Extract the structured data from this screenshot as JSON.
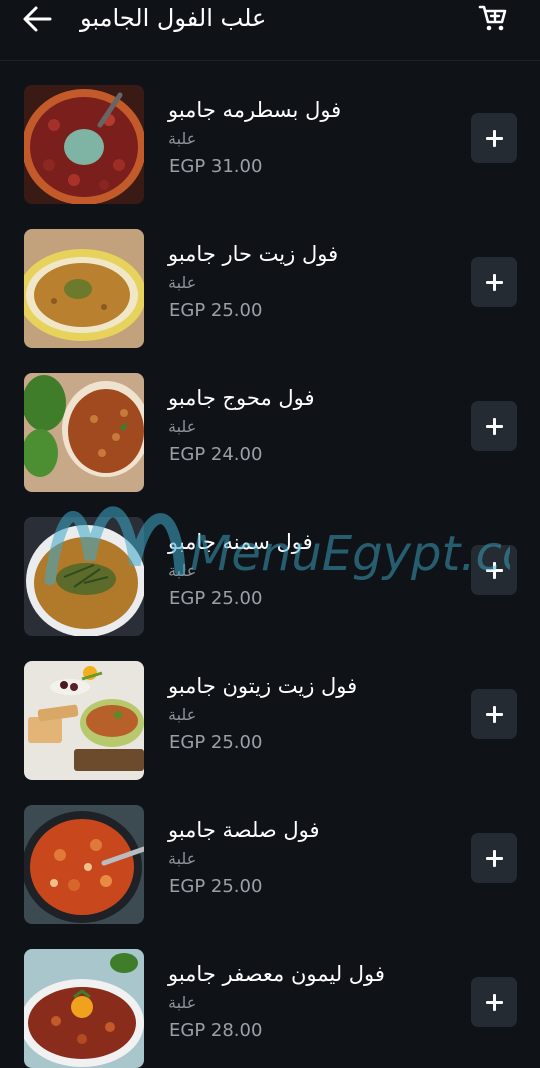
{
  "header": {
    "title": "علب الفول الجامبو",
    "back_icon": "arrow-left-icon",
    "cart_icon": "cart-icon"
  },
  "items": [
    {
      "name": "فول بسطرمه جامبو",
      "unit": "علبة",
      "price": "EGP 31.00",
      "image": "beans-with-herbs-photo"
    },
    {
      "name": "فول زيت حار جامبو",
      "unit": "علبة",
      "price": "EGP 25.00",
      "image": "mashed-beans-plate-photo"
    },
    {
      "name": "فول محوج جامبو",
      "unit": "علبة",
      "price": "EGP 24.00",
      "image": "spiced-beans-bowl-photo"
    },
    {
      "name": "فول سمنه جامبو",
      "unit": "علبة",
      "price": "EGP 25.00",
      "image": "beans-soup-bowl-photo"
    },
    {
      "name": "فول زيت زيتون جامبو",
      "unit": "علبة",
      "price": "EGP 25.00",
      "image": "beans-with-bread-photo"
    },
    {
      "name": "فول صلصة جامبو",
      "unit": "علبة",
      "price": "EGP 25.00",
      "image": "tomato-beans-pan-photo"
    },
    {
      "name": "فول ليمون معصفر جامبو",
      "unit": "علبة",
      "price": "EGP 28.00",
      "image": "lemon-beans-dish-photo"
    }
  ],
  "watermark": {
    "text": "MenuEgypt.com"
  },
  "colors": {
    "background": "#0f1318",
    "button": "#252b32",
    "muted_text": "#8b9199",
    "watermark": "#3fa9c9"
  }
}
